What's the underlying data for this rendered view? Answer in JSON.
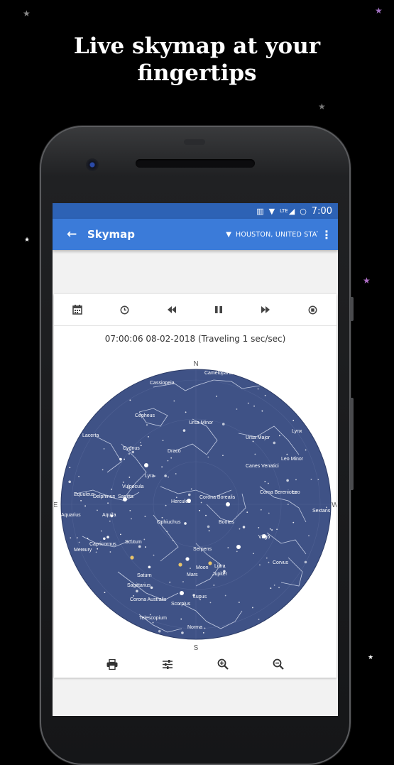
{
  "promo": {
    "headline_line1": "Live skymap at your",
    "headline_line2": "fingertips"
  },
  "status_bar": {
    "time": "7:00",
    "network": "LTE"
  },
  "app_bar": {
    "title": "Skymap",
    "location": "HOUSTON, UNITED STAT..."
  },
  "toolbar": {
    "buttons": [
      "calendar-icon",
      "clock-icon",
      "rewind-icon",
      "pause-icon",
      "fast-forward-icon",
      "stop-icon"
    ]
  },
  "simulation": {
    "time_label": "07:00:06 08-02-2018 (Traveling 1 sec/sec)"
  },
  "skymap": {
    "directions": {
      "north": "N",
      "south": "S",
      "east": "E",
      "west": "W"
    },
    "sky_color": "#3f5286",
    "labels": [
      "Cassiopeia",
      "Camelopardalis",
      "Cepheus",
      "Ursa Minor",
      "Ursa Major",
      "Lynx",
      "Lacerta",
      "Cygnus",
      "Draco",
      "Leo Minor",
      "Canes Venatici",
      "Lyra",
      "Equuleus",
      "Vulpecula",
      "Delphinus",
      "Sagitta",
      "Hercules",
      "Corona Borealis",
      "Coma Berenices",
      "Leo",
      "Aquarius",
      "Aquila",
      "Ophiuchus",
      "Bootes",
      "Sextans",
      "Capricornus",
      "Scutum",
      "Serpens",
      "Virgo",
      "Mercury",
      "Moon",
      "Libra",
      "Jupiter",
      "Mars",
      "Saturn",
      "Corvus",
      "Sagittarius",
      "Corona Australis",
      "Lupus",
      "Scorpius",
      "Telescopium",
      "Norma"
    ]
  },
  "bottom_bar": {
    "buttons": [
      "print-icon",
      "settings-sliders-icon",
      "zoom-in-icon",
      "zoom-out-icon"
    ]
  }
}
